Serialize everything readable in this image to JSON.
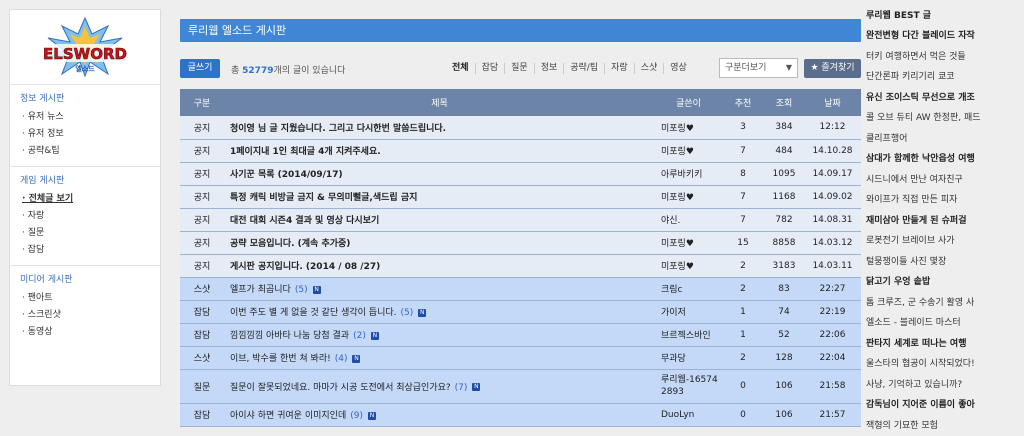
{
  "logo": {
    "text": "ELSWORD",
    "sub": "엘소드"
  },
  "left": {
    "sections": [
      {
        "title": "정보 게시판",
        "items": [
          "유저 뉴스",
          "유저 정보",
          "공략&팁"
        ]
      },
      {
        "title": "게임 게시판",
        "items": [
          "전체글 보기",
          "자랑",
          "질문",
          "잡담"
        ]
      },
      {
        "title": "미디어 게시판",
        "items": [
          "팬아트",
          "스크린샷",
          "동영상"
        ]
      }
    ]
  },
  "board": {
    "title": "루리웹 엘소드 게시판",
    "write_label": "글쓰기",
    "count_prefix": "총",
    "count": "52779",
    "count_suffix": "개의 글이 있습니다",
    "categories": [
      "전체",
      "잡담",
      "질문",
      "정보",
      "공략/팁",
      "자랑",
      "스샷",
      "영상"
    ],
    "select_value": "구분더보기",
    "fav_label": "★ 즐겨찾기",
    "columns": [
      "구분",
      "제목",
      "글쓴이",
      "추천",
      "조회",
      "날짜"
    ],
    "rows": [
      {
        "cat": "공지",
        "title": "청이영 님 글 지웠습니다. 그리고 다시한번 말씀드립니다.",
        "comments": "",
        "new": false,
        "author": "미포링♥",
        "rec": "3",
        "views": "384",
        "date": "12:12",
        "notice": true
      },
      {
        "cat": "공지",
        "title": "1페이지내 1인 최대글 4개 지켜주세요.",
        "comments": "",
        "new": false,
        "author": "미포링♥",
        "rec": "7",
        "views": "484",
        "date": "14.10.28",
        "notice": true
      },
      {
        "cat": "공지",
        "title": "사기꾼 목록 (2014/09/17)",
        "comments": "",
        "new": false,
        "author": "아루바키키",
        "rec": "8",
        "views": "1095",
        "date": "14.09.17",
        "notice": true
      },
      {
        "cat": "공지",
        "title": "특정 캐릭 비방글 금지 & 무의미뻘글,색드립 금지",
        "comments": "",
        "new": false,
        "author": "미포링♥",
        "rec": "7",
        "views": "1168",
        "date": "14.09.02",
        "notice": true
      },
      {
        "cat": "공지",
        "title": "대전 대회 시즌4 결과 및 영상 다시보기",
        "comments": "",
        "new": false,
        "author": "야신.",
        "rec": "7",
        "views": "782",
        "date": "14.08.31",
        "notice": true
      },
      {
        "cat": "공지",
        "title": "공략 모음입니다. (계속 추가중)",
        "comments": "",
        "new": false,
        "author": "미포링♥",
        "rec": "15",
        "views": "8858",
        "date": "14.03.12",
        "notice": true
      },
      {
        "cat": "공지",
        "title": "게시판 공지입니다. (2014 / 08 /27)",
        "comments": "",
        "new": false,
        "author": "미포링♥",
        "rec": "2",
        "views": "3183",
        "date": "14.03.11",
        "notice": true
      },
      {
        "cat": "스샷",
        "title": "엘프가 최곱니다",
        "comments": "(5)",
        "new": true,
        "author": "크림c",
        "rec": "2",
        "views": "83",
        "date": "22:27",
        "notice": false
      },
      {
        "cat": "잡담",
        "title": "이번 주도 별 게 없을 것 같단 생각이 듭니다.",
        "comments": "(5)",
        "new": true,
        "author": "가이저",
        "rec": "1",
        "views": "74",
        "date": "22:19",
        "notice": false
      },
      {
        "cat": "잡담",
        "title": "낌낌낌낌 아바타 나눔 당첨 결과",
        "comments": "(2)",
        "new": true,
        "author": "브르젝스바인",
        "rec": "1",
        "views": "52",
        "date": "22:06",
        "notice": false
      },
      {
        "cat": "스샷",
        "title": "이브, 박수를 한번 쳐 봐라!",
        "comments": "(4)",
        "new": true,
        "author": "무과당",
        "rec": "2",
        "views": "128",
        "date": "22:04",
        "notice": false
      },
      {
        "cat": "질문",
        "title": "질문이 잘못되었네요. 마마가 시공 도전에서 최상급인가요?",
        "comments": "(7)",
        "new": true,
        "author": "루리웹-165742893",
        "rec": "0",
        "views": "106",
        "date": "21:58",
        "notice": false,
        "tall": true
      },
      {
        "cat": "잡담",
        "title": "아이샤 하면 귀여운 이미지인데",
        "comments": "(9)",
        "new": true,
        "author": "DuoLyn",
        "rec": "0",
        "views": "106",
        "date": "21:57",
        "notice": false
      }
    ]
  },
  "best": {
    "title": "루리웹 BEST 글",
    "items": [
      {
        "text": "완전변형 다간 블레이드 자작",
        "bold": true
      },
      {
        "text": "터키 여행하면서 먹은 것들",
        "bold": false
      },
      {
        "text": "단간론파 키리기리 쿄코",
        "bold": false
      },
      {
        "text": "유신 조이스틱 무선으로 개조",
        "bold": true
      },
      {
        "text": "콜 오브 듀티 AW 한정판, 패드",
        "bold": false
      },
      {
        "text": "클리프행어",
        "bold": false
      },
      {
        "text": "삼대가 함께한 낙안읍성 여행",
        "bold": true
      },
      {
        "text": "시드니에서 만난 여자친구",
        "bold": false
      },
      {
        "text": "와이프가 직접 만든 피자",
        "bold": false
      },
      {
        "text": "재미삼아 만들게 된 슈퍼걸",
        "bold": true
      },
      {
        "text": "로봇전기 브레이브 사가",
        "bold": false
      },
      {
        "text": "털뭉쟁이들 사진 몇장",
        "bold": false
      },
      {
        "text": "닭고기 우엉 솥밥",
        "bold": true
      },
      {
        "text": "톰 크루즈, 군 수송기 활영 사",
        "bold": false
      },
      {
        "text": "엘소드 - 블레이드 마스터",
        "bold": false
      },
      {
        "text": "판타지 세계로 떠나는 여행",
        "bold": true
      },
      {
        "text": "울스타의 협공이 시작되었다!",
        "bold": false
      },
      {
        "text": "사냥, 기억하고 있습니까?",
        "bold": false
      },
      {
        "text": "감독님이 지어준 이름이 좋아",
        "bold": true
      },
      {
        "text": "잭형의 기묘한 모험",
        "bold": false
      }
    ]
  }
}
